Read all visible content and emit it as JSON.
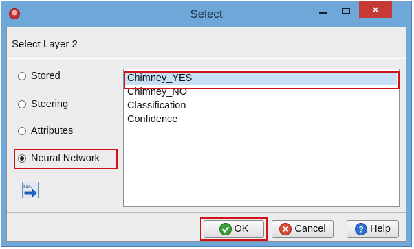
{
  "window": {
    "title": "Select",
    "close_label": "×"
  },
  "dialog": {
    "heading": "Select Layer 2"
  },
  "options": [
    {
      "label": "Stored",
      "selected": false
    },
    {
      "label": "Steering",
      "selected": false
    },
    {
      "label": "Attributes",
      "selected": false
    },
    {
      "label": "Neural Network",
      "selected": true
    }
  ],
  "list": {
    "items": [
      "Chimney_YES",
      "Chimney_NO",
      "Classification",
      "Confidence"
    ],
    "selected_index": 0
  },
  "buttons": {
    "ok": "OK",
    "cancel": "Cancel",
    "help": "Help"
  },
  "seg_icon_label": "SEG",
  "colors": {
    "titlebar": "#6fa7d8",
    "close": "#c63a36",
    "highlight": "#d0131b",
    "selection": "#c6e0f6"
  }
}
